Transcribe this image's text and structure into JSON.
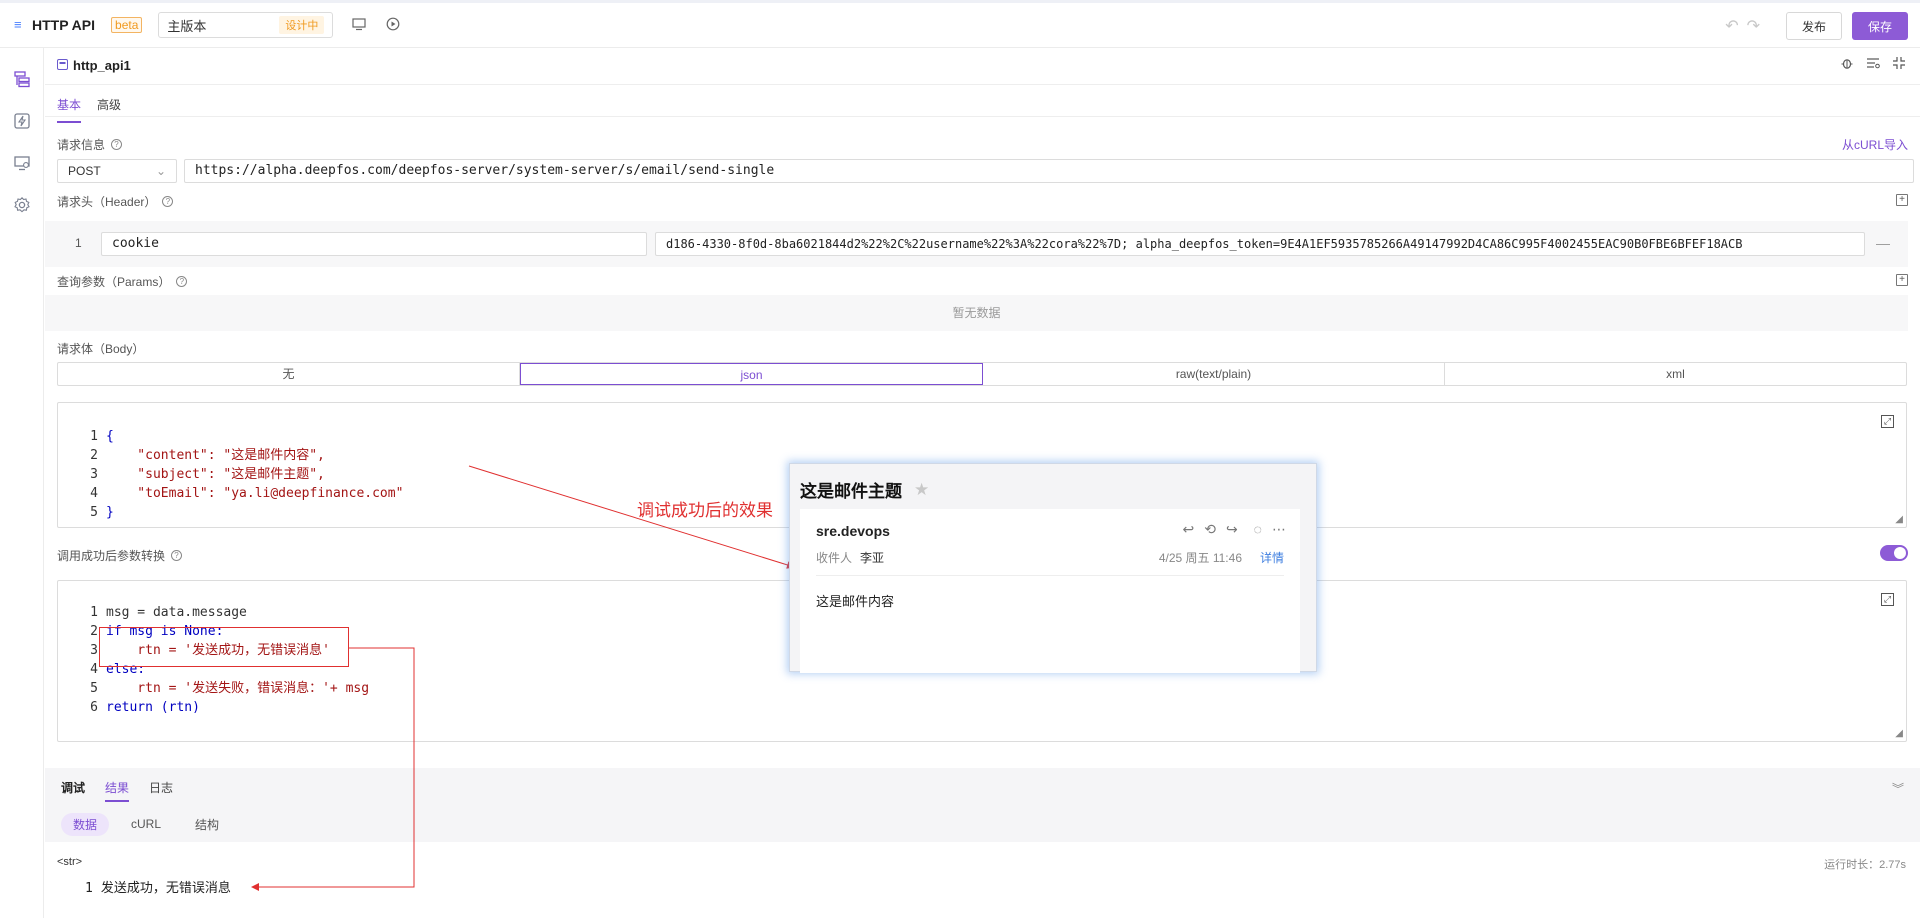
{
  "app": {
    "title": "HTTP API",
    "badge": "beta",
    "version": "主版本",
    "version_status": "设计中"
  },
  "toolbar": {
    "publish_label": "发布",
    "save_label": "保存"
  },
  "panel": {
    "title": "http_api1",
    "tabs": [
      {
        "label": "基本"
      },
      {
        "label": "高级"
      }
    ]
  },
  "request": {
    "label": "请求信息",
    "import_curl": "从cURL导入",
    "method": "POST",
    "url": "https://alpha.deepfos.com/deepfos-server/system-server/s/email/send-single"
  },
  "headers": {
    "label": "请求头（Header）",
    "rows": [
      {
        "index": "1",
        "key": "cookie",
        "value": "d186-4330-8f0d-8ba6021844d2%22%2C%22username%22%3A%22cora%22%7D; alpha_deepfos_token=9E4A1EF5935785266A49147992D4CA86C995F4002455EAC90B0FBE6BFEF18ACB"
      }
    ]
  },
  "params": {
    "label": "查询参数（Params）",
    "empty": "暂无数据"
  },
  "body": {
    "label": "请求体（Body）",
    "types": [
      {
        "label": "无"
      },
      {
        "label": "json"
      },
      {
        "label": "raw(text/plain)"
      },
      {
        "label": "xml"
      }
    ],
    "selected": "json",
    "code_lines": [
      {
        "n": "1",
        "text": "{"
      },
      {
        "n": "2",
        "text": "    \"content\": \"这是邮件内容\","
      },
      {
        "n": "3",
        "text": "    \"subject\": \"这是邮件主题\","
      },
      {
        "n": "4",
        "text": "    \"toEmail\": \"ya.li@deepfinance.com\""
      },
      {
        "n": "5",
        "text": "}"
      }
    ]
  },
  "transform": {
    "label": "调用成功后参数转换",
    "enabled": true,
    "code_lines": [
      {
        "n": "1",
        "text": "msg = data.message"
      },
      {
        "n": "2",
        "text": "if msg is None:"
      },
      {
        "n": "3",
        "text": "    rtn = '发送成功，无错误消息'"
      },
      {
        "n": "4",
        "text": "else:"
      },
      {
        "n": "5",
        "text": "    rtn = '发送失败，错误消息：'+ msg"
      },
      {
        "n": "6",
        "text": "return (rtn)"
      }
    ]
  },
  "debug": {
    "tabs": [
      {
        "label": "调试"
      },
      {
        "label": "结果"
      },
      {
        "label": "日志"
      }
    ],
    "sub_tabs": [
      {
        "label": "数据"
      },
      {
        "label": "cURL"
      },
      {
        "label": "结构"
      }
    ],
    "result_type": "<str>",
    "runtime": "运行时长：2.77s",
    "result_index": "1",
    "result_value": "发送成功，无错误消息"
  },
  "annotation": {
    "text": "调试成功后的效果"
  },
  "email": {
    "subject": "这是邮件主题",
    "sender": "sre.devops",
    "recipient_label": "收件人",
    "recipient": "李亚",
    "date": "4/25 周五 11:46",
    "detail": "详情",
    "content": "这是邮件内容"
  },
  "colors": {
    "accent": "#8d5bd6",
    "annotation": "#e03030",
    "warning": "#f09a20"
  }
}
